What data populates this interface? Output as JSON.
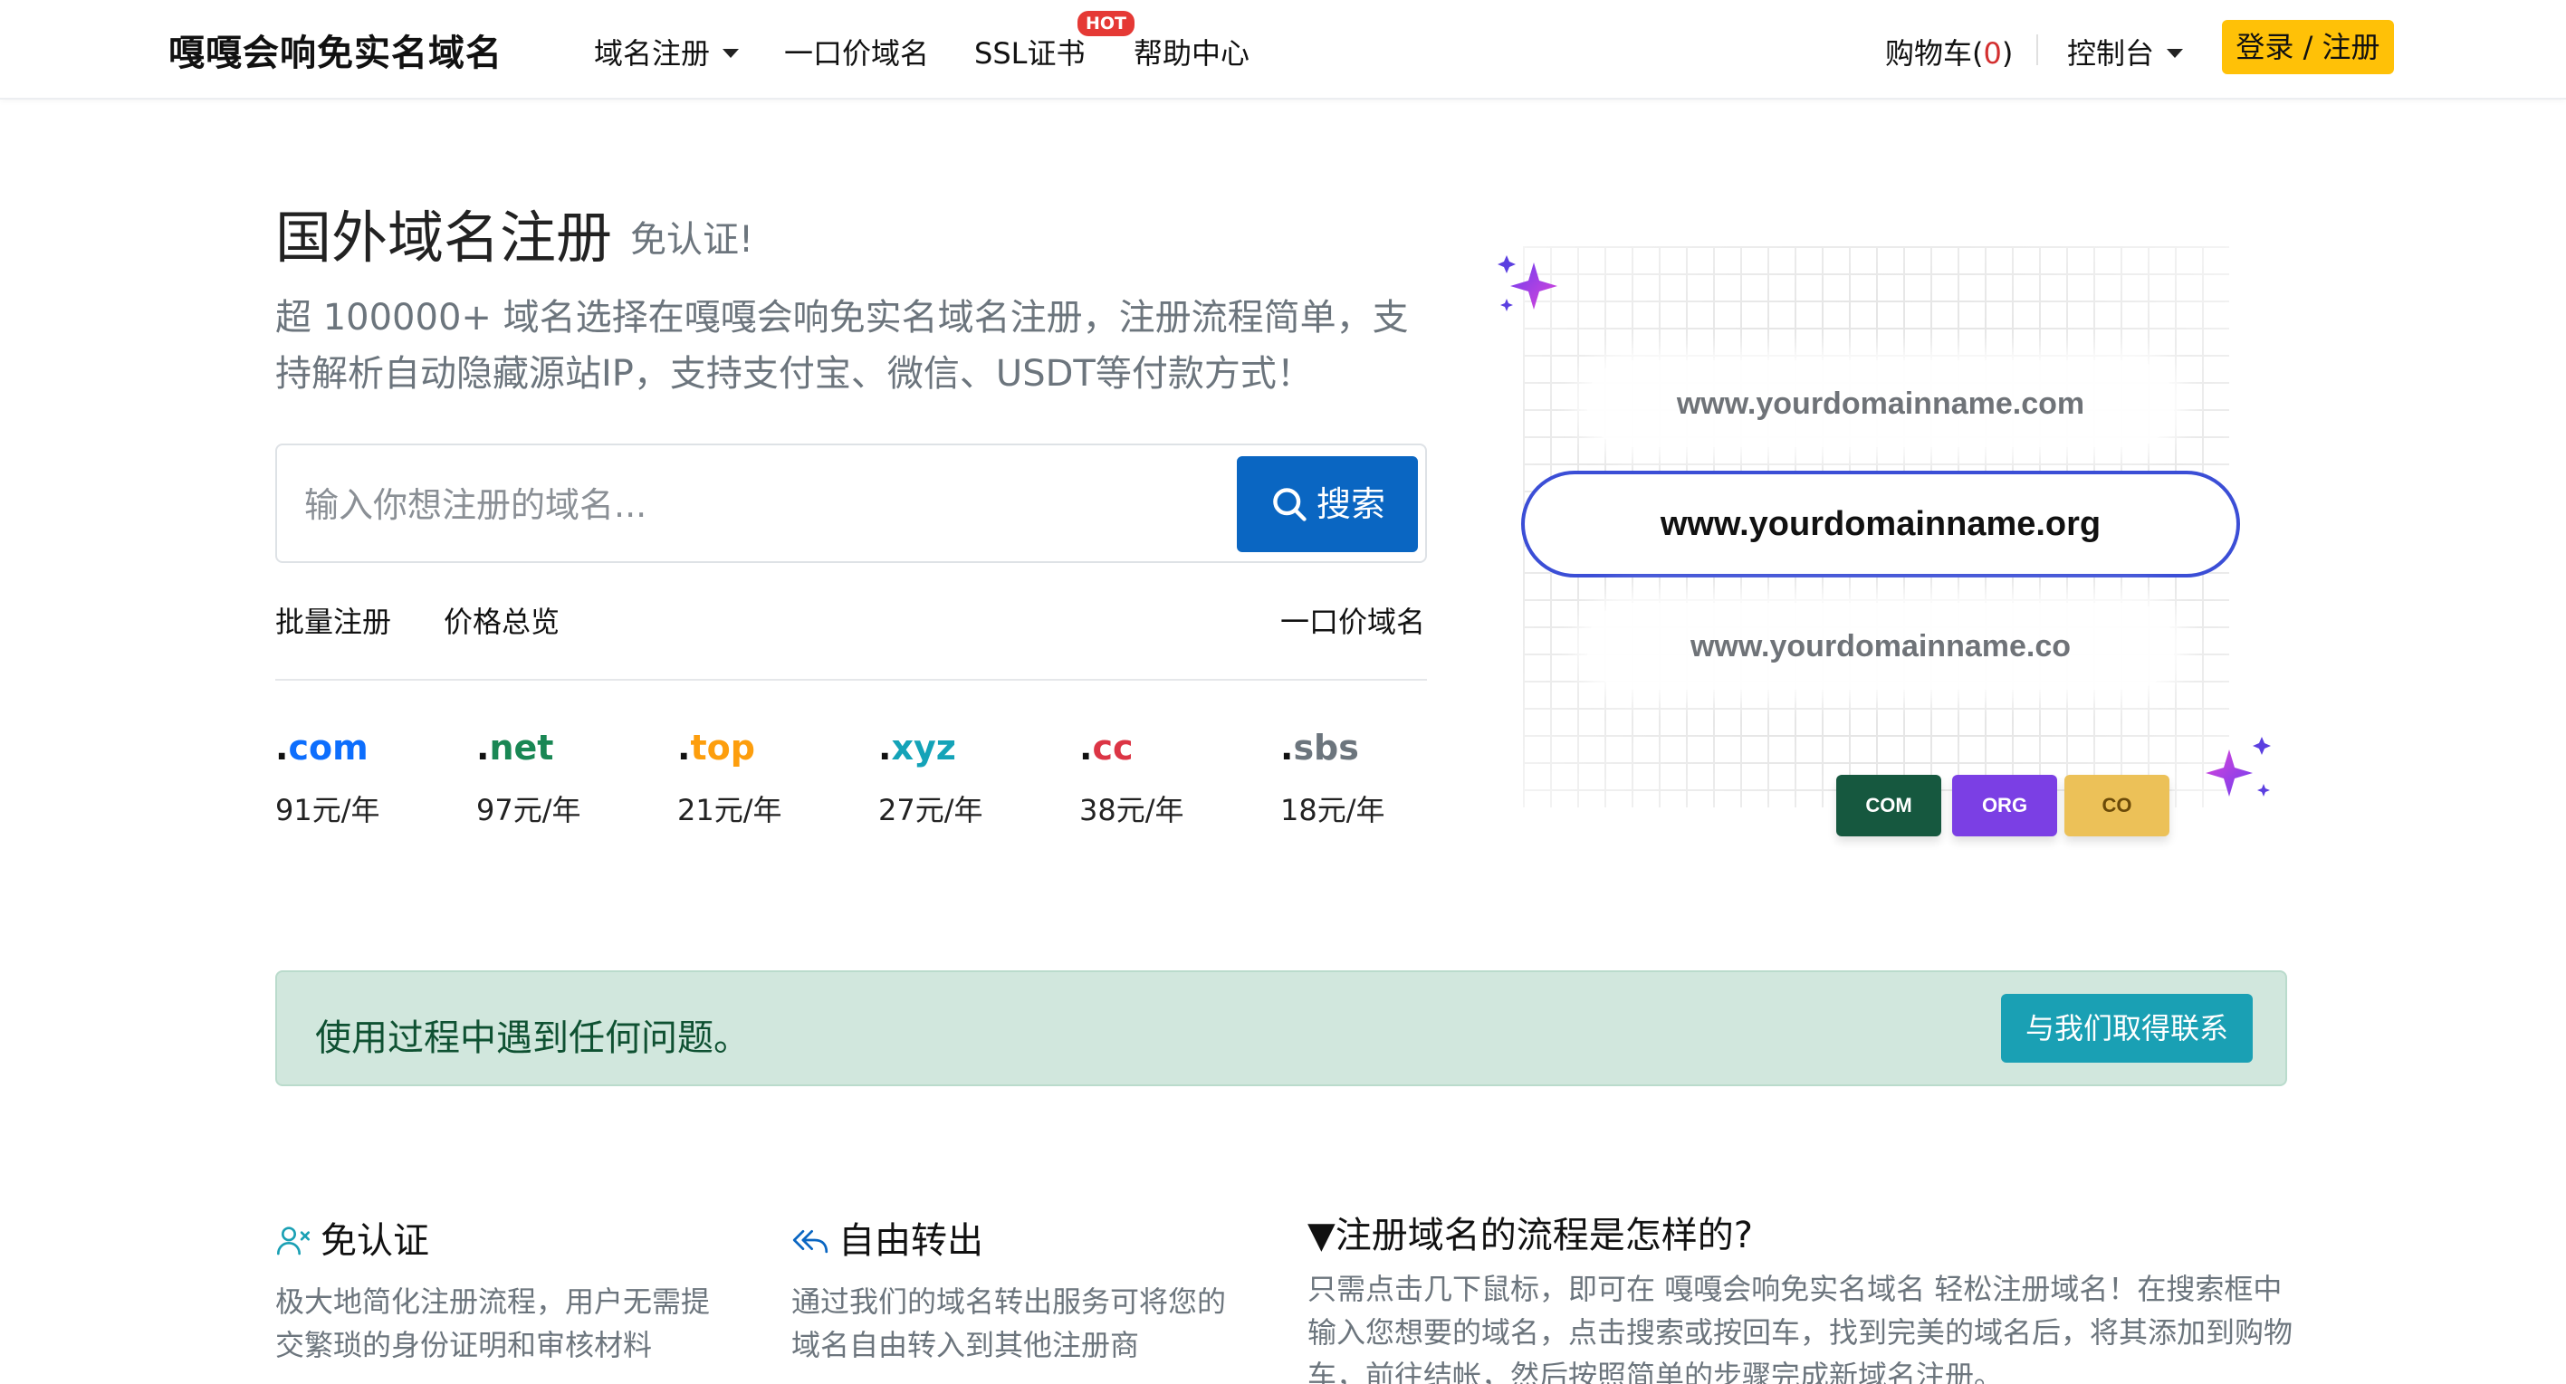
{
  "nav": {
    "brand": "嘎嘎会响免实名域名",
    "items": [
      {
        "label": "域名注册"
      },
      {
        "label": "一口价域名"
      },
      {
        "label": "SSL证书"
      },
      {
        "label": "帮助中心"
      }
    ],
    "hot_badge": "HOT",
    "cart_label": "购物车(",
    "cart_count": "0",
    "cart_close": ")",
    "console_label": "控制台",
    "login_label": "登录 / 注册"
  },
  "hero": {
    "title": "国外域名注册",
    "subtitle": "免认证!",
    "description": "超 100000+ 域名选择在嘎嘎会响免实名域名注册，注册流程简单，支持解析自动隐藏源站IP，支持支付宝、微信、USDT等付款方式！",
    "search_placeholder": "输入你想注册的域名...",
    "search_value": "",
    "search_button": "搜索",
    "links": {
      "bulk": "批量注册",
      "prices": "价格总览",
      "fixed_price": "一口价域名"
    },
    "tlds": [
      {
        "dot": ".",
        "name": "com",
        "price": "91元/年",
        "color": "#0d6efd"
      },
      {
        "dot": ".",
        "name": "net",
        "price": "97元/年",
        "color": "#198754"
      },
      {
        "dot": ".",
        "name": "top",
        "price": "21元/年",
        "color": "#fd9e0d"
      },
      {
        "dot": ".",
        "name": "xyz",
        "price": "27元/年",
        "color": "#14a3b8"
      },
      {
        "dot": ".",
        "name": "cc",
        "price": "38元/年",
        "color": "#dc3545"
      },
      {
        "dot": ".",
        "name": "sbs",
        "price": "18元/年",
        "color": "#6c757d"
      }
    ]
  },
  "illustration": {
    "domain_top": "www.yourdomainname.com",
    "domain_main": "www.yourdomainname.org",
    "domain_bottom": "www.yourdomainname.co",
    "tags": [
      {
        "label": "COM",
        "color": "#16583f"
      },
      {
        "label": "ORG",
        "color": "#7b3fe4"
      },
      {
        "label": "CO",
        "color": "#ecc158"
      }
    ]
  },
  "alert": {
    "text": "使用过程中遇到任何问题。",
    "button": "与我们取得联系"
  },
  "features": [
    {
      "title": "免认证",
      "text": "极大地简化注册流程，用户无需提交繁琐的身份证明和审核材料"
    },
    {
      "title": "自由转出",
      "text": "通过我们的域名转出服务可将您的域名自由转入到其他注册商"
    }
  ],
  "faq": {
    "title": "▼注册域名的流程是怎样的?",
    "text": "只需点击几下鼠标，即可在 嘎嘎会响免实名域名 轻松注册域名！在搜索框中输入您想要的域名，点击搜索或按回车，找到完美的域名后，将其添加到购物车，前往结帐，然后按照简单的步骤完成新域名注册。"
  },
  "colors": {
    "accent": "#0a66c2",
    "login": "#ffc107",
    "alert_bg": "#d1e7dd",
    "alert_text": "#0f5132",
    "contact": "#1aa0b4",
    "hot": "#e53935"
  }
}
